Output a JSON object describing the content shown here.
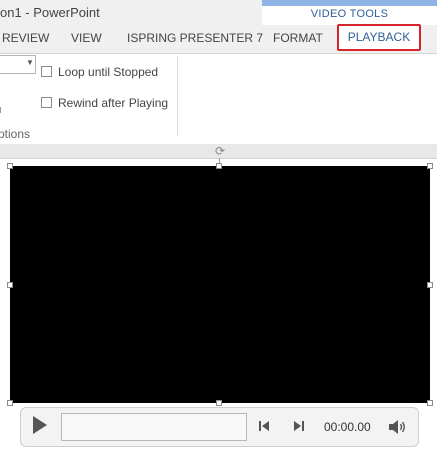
{
  "window": {
    "title": "on1 - PowerPoint",
    "context_group": "VIDEO TOOLS"
  },
  "tabs": {
    "review": "REVIEW",
    "view": "VIEW",
    "ispring": "ISPRING PRESENTER 7",
    "format": "FORMAT",
    "playback": "PLAYBACK"
  },
  "ribbon": {
    "loop_label": "Loop until Stopped",
    "loop_checked": false,
    "rewind_label": "Rewind after Playing",
    "rewind_checked": false,
    "group_label": "ptions"
  },
  "player": {
    "time": "00:00.00",
    "progress": 0
  },
  "colors": {
    "highlight_border": "#d4252b",
    "context_accent": "#8fb4e3",
    "video_background": "#000000"
  },
  "icons": {
    "play": "play-icon",
    "previous": "step-back-icon",
    "next": "step-forward-icon",
    "volume": "volume-icon",
    "rotate": "rotate-icon"
  }
}
